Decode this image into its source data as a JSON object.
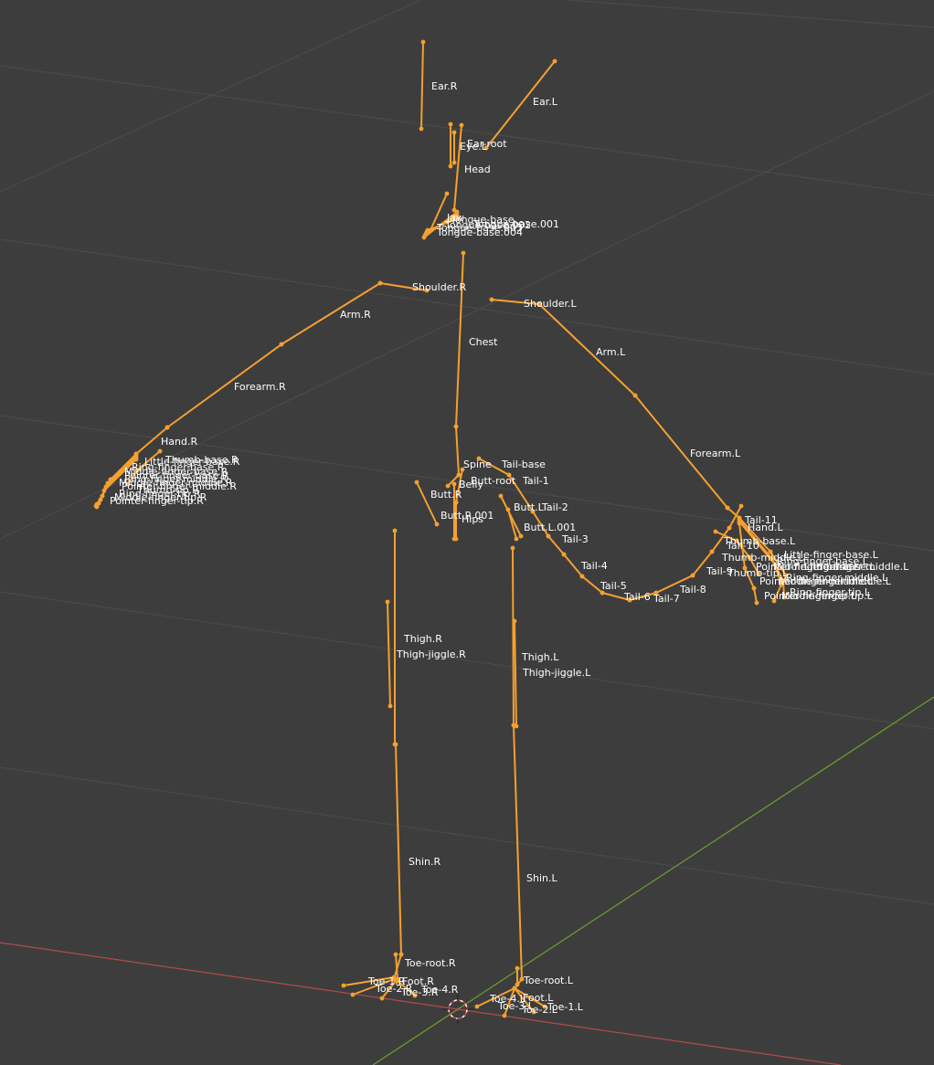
{
  "app": "Blender 3D Viewport - Armature (Edit/Pose)",
  "colors": {
    "background": "#3d3d3d",
    "bone": "#f5a030",
    "grid": "#4a4a4a",
    "axis_x": "#b24a4a",
    "axis_y": "#6b9a2e",
    "label": "#ffffff"
  },
  "bones": [
    {
      "name": "Ear.R"
    },
    {
      "name": "Ear.L"
    },
    {
      "name": "Ear-root"
    },
    {
      "name": "Eye.L"
    },
    {
      "name": "Head"
    },
    {
      "name": "Jaw"
    },
    {
      "name": "Tongue-base"
    },
    {
      "name": "Tongue-base.001"
    },
    {
      "name": "Tongue-base.002"
    },
    {
      "name": "Tongue-base.003"
    },
    {
      "name": "Tongue-base.004"
    },
    {
      "name": "Shoulder.R"
    },
    {
      "name": "Shoulder.L"
    },
    {
      "name": "Arm.R"
    },
    {
      "name": "Arm.L"
    },
    {
      "name": "Chest"
    },
    {
      "name": "Forearm.R"
    },
    {
      "name": "Forearm.L"
    },
    {
      "name": "Hand.R"
    },
    {
      "name": "Hand.L"
    },
    {
      "name": "Thumb-base.R"
    },
    {
      "name": "Little-finger-base.R"
    },
    {
      "name": "Ring-finger-base.R"
    },
    {
      "name": "Middle-finger-base.R"
    },
    {
      "name": "Pointer-finger-base.R"
    },
    {
      "name": "Ring-finger-middle.R"
    },
    {
      "name": "Middle-finger-middle.R"
    },
    {
      "name": "Pointer-finger-middle.R"
    },
    {
      "name": "Thumb-tip.R"
    },
    {
      "name": "Ring-finger-tip.R"
    },
    {
      "name": "Middle-finger-tip.R"
    },
    {
      "name": "Pointer-finger-tip.R"
    },
    {
      "name": "Spine"
    },
    {
      "name": "Tail-base"
    },
    {
      "name": "Belly"
    },
    {
      "name": "Butt-root"
    },
    {
      "name": "Tail-1"
    },
    {
      "name": "Butt.R"
    },
    {
      "name": "Butt.L"
    },
    {
      "name": "Tail-2"
    },
    {
      "name": "Butt.R.001"
    },
    {
      "name": "Hips"
    },
    {
      "name": "Butt.L.001"
    },
    {
      "name": "Tail-3"
    },
    {
      "name": "Tail-4"
    },
    {
      "name": "Tail-5"
    },
    {
      "name": "Tail-6"
    },
    {
      "name": "Tail-7"
    },
    {
      "name": "Tail-8"
    },
    {
      "name": "Tail-9"
    },
    {
      "name": "Tail-10"
    },
    {
      "name": "Tail-11"
    },
    {
      "name": "Thumb-base.L"
    },
    {
      "name": "Thumb-middle.L"
    },
    {
      "name": "Thumb-tip.L"
    },
    {
      "name": "Little-finger-base.L"
    },
    {
      "name": "Ring-finger-base.L"
    },
    {
      "name": "Middle-finger-base.L"
    },
    {
      "name": "Pointer-finger-base.L"
    },
    {
      "name": "Little-finger-middle.L"
    },
    {
      "name": "Ring-finger-middle.L"
    },
    {
      "name": "Middle-finger-middle.L"
    },
    {
      "name": "Pointer-finger-middle.L"
    },
    {
      "name": "Ring-finger-tip.L"
    },
    {
      "name": "Middle-finger-tip.L"
    },
    {
      "name": "Pointer-finger-tip.L"
    },
    {
      "name": "Thigh.R"
    },
    {
      "name": "Thigh-jiggle.R"
    },
    {
      "name": "Thigh.L"
    },
    {
      "name": "Thigh-jiggle.L"
    },
    {
      "name": "Shin.R"
    },
    {
      "name": "Shin.L"
    },
    {
      "name": "Toe-root.R"
    },
    {
      "name": "Foot.R"
    },
    {
      "name": "Toe-1.R"
    },
    {
      "name": "Toe-2.R"
    },
    {
      "name": "Toe-3.R"
    },
    {
      "name": "Toe-4.R"
    },
    {
      "name": "Toe-root.L"
    },
    {
      "name": "Foot.L"
    },
    {
      "name": "Toe-1.L"
    },
    {
      "name": "Toe-2.L"
    },
    {
      "name": "Toe-3.L"
    },
    {
      "name": "Toe-4.L"
    }
  ]
}
